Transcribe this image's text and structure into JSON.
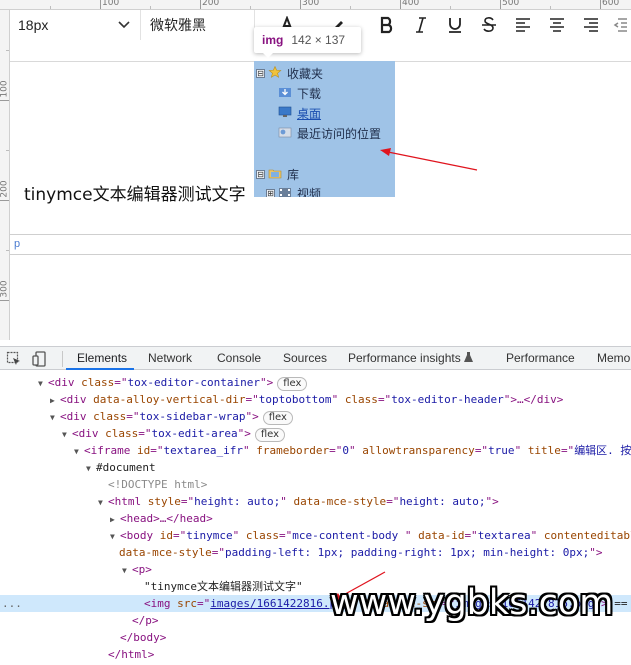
{
  "rulers": {
    "top_labels": [
      "100",
      "200",
      "300",
      "400",
      "500",
      "600"
    ],
    "left_labels": [
      "100",
      "200",
      "300"
    ]
  },
  "toolbar": {
    "font_size": "18px",
    "font_family": "微软雅黑",
    "icons": [
      "font-color-icon",
      "highlight-icon",
      "bold-icon",
      "italic-icon",
      "underline-icon",
      "strikethrough-icon",
      "align-left-icon",
      "align-center-icon",
      "align-right-icon",
      "outdent-icon"
    ]
  },
  "editor": {
    "text": "tinymce文本编辑器测试文字",
    "path": "p"
  },
  "tooltip": {
    "tag": "img",
    "dims": "142 × 137"
  },
  "image_content": {
    "favorites": "收藏夹",
    "items": [
      "下载",
      "桌面",
      "最近访问的位置"
    ],
    "library": "库",
    "video": "视频",
    "collapse_symbol": "⊟",
    "expand_symbol": "⊞"
  },
  "devtools": {
    "tabs": [
      "Elements",
      "Network",
      "Console",
      "Sources",
      "Performance insights",
      "Performance",
      "Memo"
    ],
    "active_tab": "Elements"
  },
  "dom": {
    "l1": {
      "tag": "div",
      "attr": "class",
      "val": "tox-editor-container",
      "badge": "flex"
    },
    "l2": {
      "tag": "div",
      "attr1": "data-alloy-vertical-dir",
      "val1": "toptobottom",
      "attr2": "class",
      "val2": "tox-editor-header",
      "tail": "…</div>"
    },
    "l3": {
      "tag": "div",
      "attr": "class",
      "val": "tox-sidebar-wrap",
      "badge": "flex"
    },
    "l4": {
      "tag": "div",
      "attr": "class",
      "val": "tox-edit-area",
      "badge": "flex"
    },
    "l5": {
      "tag": "iframe",
      "a1": "id",
      "v1": "textarea_ifr",
      "a2": "frameborder",
      "v2": "0",
      "a3": "allowtransparency",
      "v3": "true",
      "a4": "title",
      "v4": "编辑区. 按"
    },
    "l6": "#document",
    "l7": "<!DOCTYPE html>",
    "l8": {
      "tag": "html",
      "a1": "style",
      "v1": "height: auto;",
      "a2": "data-mce-style",
      "v2": "height: auto;"
    },
    "l9": {
      "tag": "head",
      "tail": "…</head>"
    },
    "l10": {
      "tag": "body",
      "a1": "id",
      "v1": "tinymce",
      "a2": "class",
      "v2": "mce-content-body ",
      "a3": "data-id",
      "v3": "textarea",
      "a4": "contenteditabl"
    },
    "l11": {
      "a1": "data-mce-style",
      "v1": "padding-left: 1px; padding-right: 1px; min-height: 0px;"
    },
    "l12": {
      "tag": "p"
    },
    "l13": "\"tinymce文本编辑器测试文字\"",
    "l14": {
      "tag": "img",
      "a1": "src",
      "v1": "images/1661422816.png",
      "a2": "data-mce-src",
      "v2": "images/1661422816.png",
      "tail": "== $0"
    },
    "l15": "</p>",
    "l16": "</body>",
    "l17": "</html>",
    "dots": "..."
  },
  "watermark": "www.ygbks.com",
  "colors": {
    "image_bg": "#9fc3e7",
    "selected_row": "#cfe8fc",
    "tab_underline": "#1a73e8",
    "arrow": "#e0141e"
  }
}
